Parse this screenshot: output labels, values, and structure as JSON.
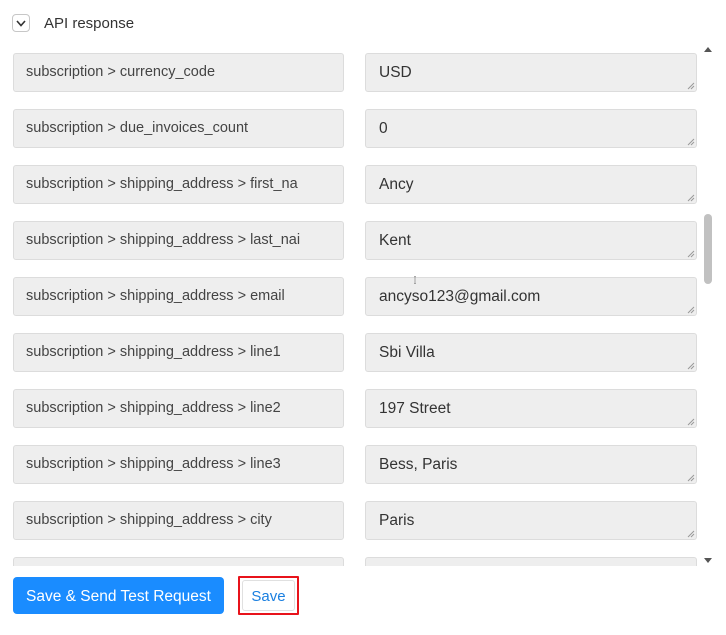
{
  "section": {
    "title": "API response",
    "toggle_icon": "chevron-down-icon"
  },
  "fields": [
    {
      "key": "subscription > currency_code",
      "value": "USD"
    },
    {
      "key": "subscription > due_invoices_count",
      "value": "0"
    },
    {
      "key": "subscription > shipping_address > first_na",
      "value": "Ancy"
    },
    {
      "key": "subscription > shipping_address > last_nai",
      "value": "Kent"
    },
    {
      "key": "subscription > shipping_address > email",
      "value": "ancyso123@gmail.com"
    },
    {
      "key": "subscription > shipping_address > line1",
      "value": "Sbi Villa"
    },
    {
      "key": "subscription > shipping_address > line2",
      "value": "197 Street"
    },
    {
      "key": "subscription > shipping_address > line3",
      "value": "Bess, Paris"
    },
    {
      "key": "subscription > shipping_address > city",
      "value": "Paris"
    },
    {
      "key": "",
      "value": ""
    }
  ],
  "actions": {
    "send_test_label": "Save & Send Test Request",
    "save_label": "Save"
  },
  "colors": {
    "primary": "#1a8cff",
    "highlight": "#e8131b",
    "field_bg": "#eeeeee"
  }
}
